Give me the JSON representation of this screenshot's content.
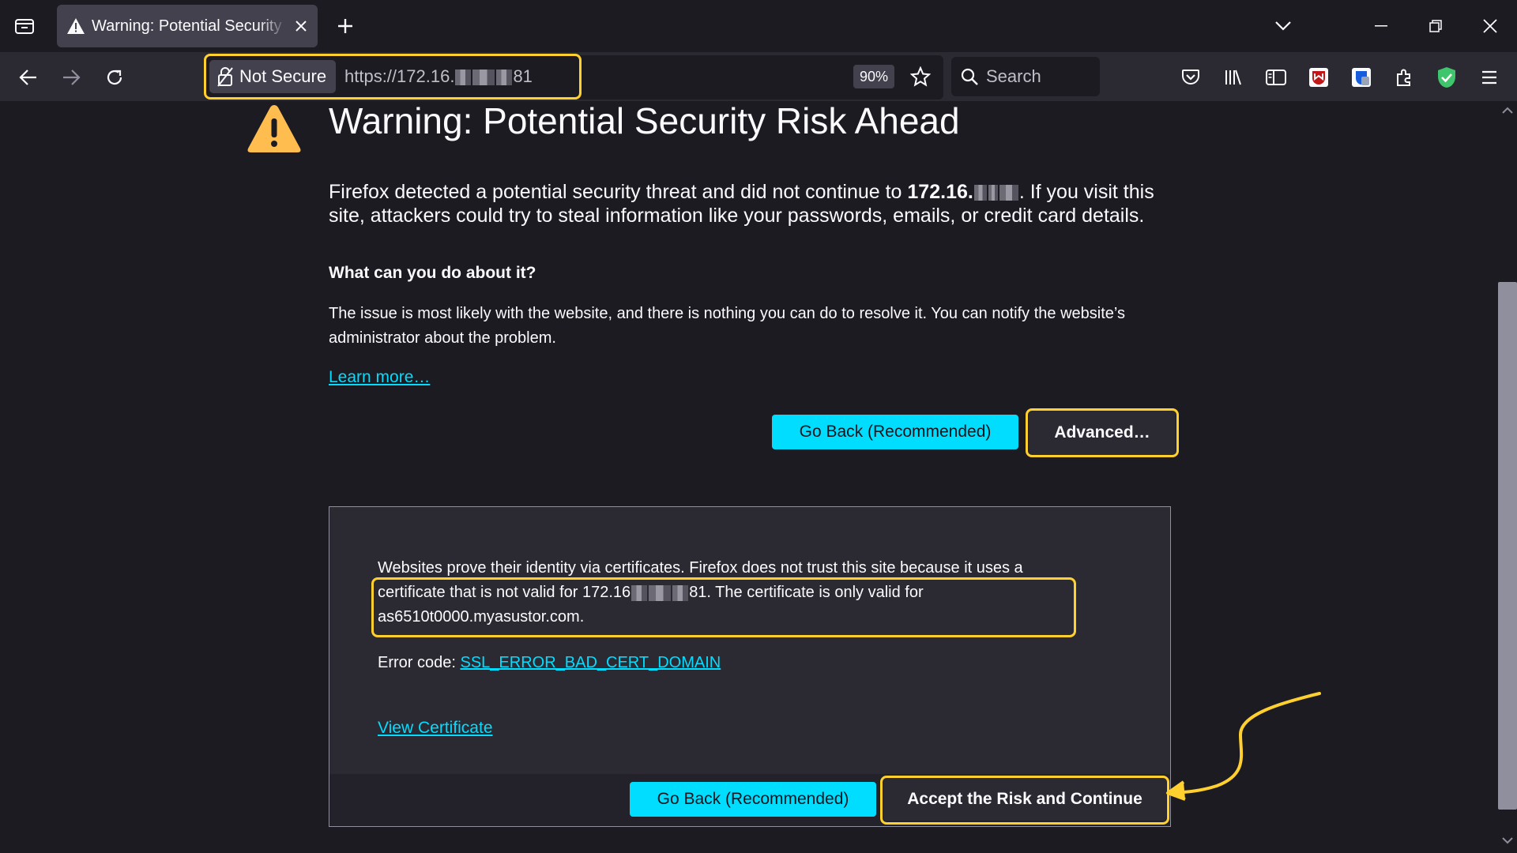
{
  "browser": {
    "tab": {
      "title": "Warning: Potential Security Risk Ahead"
    },
    "urlbar": {
      "security_label": "Not Secure",
      "url_prefix": "https://172.16.",
      "url_suffix": "81",
      "zoom": "90%"
    },
    "search": {
      "placeholder": "Search"
    }
  },
  "page": {
    "title": "Warning: Potential Security Risk Ahead",
    "intro_part1": "Firefox detected a potential security threat and did not continue to ",
    "intro_host": "172.16.",
    "intro_part2": ". If you visit this site, attackers could try to steal information like your passwords, emails, or credit card details.",
    "question": "What can you do about it?",
    "explanation": "The issue is most likely with the website, and there is nothing you can do to resolve it. You can notify the website’s administrator about the problem.",
    "learn_more": "Learn more…",
    "go_back_label": "Go Back (Recommended)",
    "advanced_label": "Advanced…"
  },
  "advanced": {
    "text_line1": "Websites prove their identity via certificates. Firefox does not trust this site because it uses a",
    "text_line2_prefix": "certificate that is not valid for 172.16",
    "text_line2_suffix": "81. The certificate is only valid for",
    "text_line3": "as6510t0000.myasustor.com.",
    "error_label": "Error code: ",
    "error_code": "SSL_ERROR_BAD_CERT_DOMAIN",
    "view_certificate": "View Certificate",
    "go_back_label": "Go Back (Recommended)",
    "accept_label": "Accept the Risk and Continue"
  },
  "colors": {
    "accent_cyan": "#00ddff",
    "highlight_yellow": "#ffd02e",
    "warning_orange": "#ffbd4f",
    "background": "#1c1b22"
  }
}
